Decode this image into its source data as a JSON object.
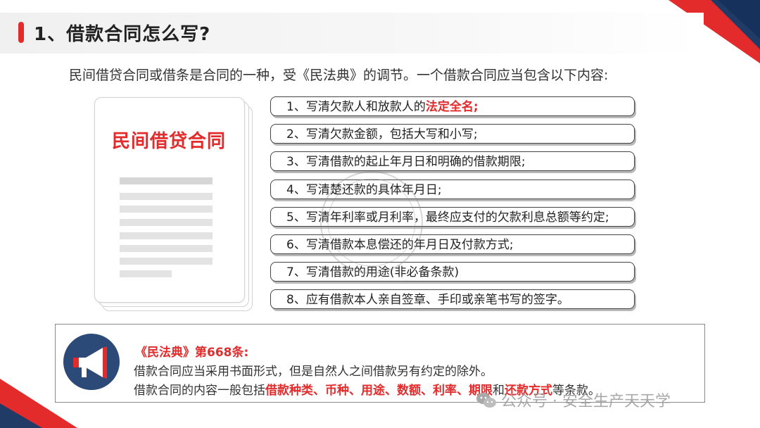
{
  "colors": {
    "accent": "#e32b2b",
    "navy": "#2c4a78",
    "box_border": "#444444"
  },
  "header": {
    "title": "1、借款合同怎么写?"
  },
  "intro": "民间借贷合同或借条是合同的一种，受《民法典》的调节。一个借款合同应当包含以下内容:",
  "document": {
    "title": "民间借贷合同"
  },
  "items": [
    {
      "text": "1、写清欠款人和放款人的",
      "highlight": "法定全名;"
    },
    {
      "text": "2、写清欠款金额，包括大写和小写;"
    },
    {
      "text": "3、写清借款的起止年月日和明确的借款期限;"
    },
    {
      "text": "4、写清楚还款的具体年月日;"
    },
    {
      "text": "5、写清年利率或月利率，最终应支付的欠款利息总额等约定;"
    },
    {
      "text": "6、写清借款本息偿还的年月日及付款方式;"
    },
    {
      "text": "7、写清借款的用途(非必备条款)"
    },
    {
      "text": "8、应有借款本人亲自签章、手印或亲笔书写的签字。"
    }
  ],
  "law": {
    "heading": "《民法典》第668条:",
    "line1": "借款合同应当采用书面形式，但是自然人之间借款另有约定的除外。",
    "line2_parts": {
      "p1": "借款合同的内容一般包括",
      "h1": "借款种类、币种、用途、数额、利率、期限",
      "p2": "和",
      "h2": "还款方式",
      "p3": "等条款。"
    }
  },
  "watermark": {
    "text": "公众号 · 安全生产天天学",
    "icon": "wechat-icon"
  },
  "icons": {
    "megaphone": "megaphone-icon",
    "stamp": "stamp-watermark"
  }
}
